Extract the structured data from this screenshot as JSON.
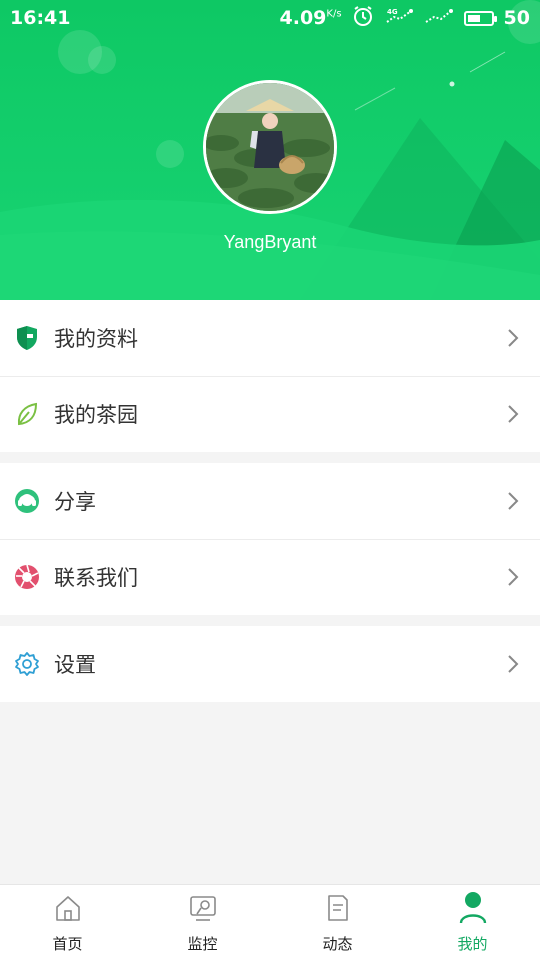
{
  "status_bar": {
    "time": "16:41",
    "speed": "4.09",
    "speed_unit": "K/s",
    "battery": "50"
  },
  "profile": {
    "username": "YangBryant"
  },
  "menu": {
    "groups": [
      [
        {
          "label": "我的资料",
          "icon": "shield-icon"
        },
        {
          "label": "我的茶园",
          "icon": "leaf-icon"
        }
      ],
      [
        {
          "label": "分享",
          "icon": "headset-icon"
        },
        {
          "label": "联系我们",
          "icon": "aperture-icon"
        }
      ],
      [
        {
          "label": "设置",
          "icon": "gear-icon"
        }
      ]
    ]
  },
  "tabbar": {
    "items": [
      {
        "label": "首页",
        "icon": "home-icon"
      },
      {
        "label": "监控",
        "icon": "monitor-icon"
      },
      {
        "label": "动态",
        "icon": "document-icon"
      },
      {
        "label": "我的",
        "icon": "person-icon"
      }
    ],
    "active_index": 3
  },
  "colors": {
    "brand": "#13c466",
    "active_tab": "#13a862"
  }
}
